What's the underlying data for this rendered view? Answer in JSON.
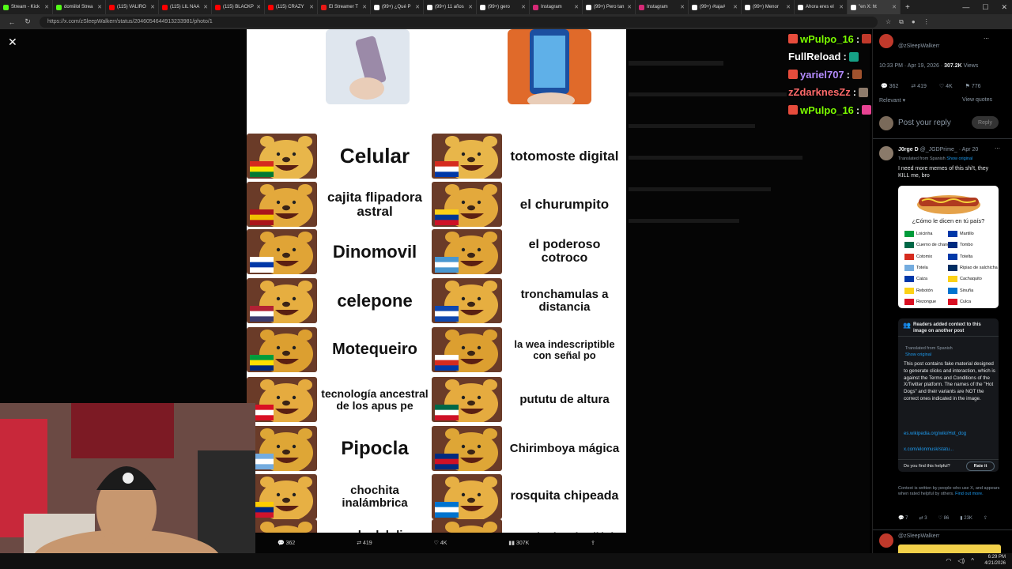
{
  "browser": {
    "tabs": [
      {
        "label": "Stream - Kick",
        "color": "#53fc18"
      },
      {
        "label": "domiilol Strea",
        "color": "#53fc18"
      },
      {
        "label": "(115) VALIRO",
        "color": "#ff0000"
      },
      {
        "label": "(115) LIL NAA",
        "color": "#ff0000"
      },
      {
        "label": "(115) BLACKP",
        "color": "#ff0000"
      },
      {
        "label": "(115) CRAZY",
        "color": "#ff0000"
      },
      {
        "label": "El Streamer T",
        "color": "#e91916"
      },
      {
        "label": "(99+) ¿Qué P",
        "color": "#ffffff"
      },
      {
        "label": "(99+) 11 años",
        "color": "#ffffff"
      },
      {
        "label": "(99+) gero",
        "color": "#ffffff"
      },
      {
        "label": "Instagram",
        "color": "#d62976"
      },
      {
        "label": "(99+) Pero tan",
        "color": "#ffffff"
      },
      {
        "label": "Instagram",
        "color": "#d62976"
      },
      {
        "label": "(99+) #taja#",
        "color": "#ffffff"
      },
      {
        "label": "(99+) Menor",
        "color": "#ffffff"
      },
      {
        "label": "Ahora eres el",
        "color": "#ffffff"
      },
      {
        "label": "\"en X: ht",
        "color": "#ffffff"
      }
    ],
    "url": "https://x.com/zSleepWalkerr/status/2046054644913233981/photo/1"
  },
  "meme": {
    "left": [
      {
        "label": "Celular",
        "pooh": "#e8b64a",
        "flag": [
          "#d52b1e",
          "#f9e300",
          "#007934"
        ]
      },
      {
        "label": "cajita flipadora astral",
        "pooh": "#e3a93c",
        "flag": [
          "#aa151b",
          "#f1bf00",
          "#aa151b"
        ]
      },
      {
        "label": "Dinomovil",
        "pooh": "#e0a436",
        "flag": [
          "#ffffff",
          "#0038a8",
          "#ffffff"
        ]
      },
      {
        "label": "celepone",
        "pooh": "#e6ae40",
        "flag": [
          "#b22234",
          "#ffffff",
          "#3c3b6e"
        ]
      },
      {
        "label": "Motequeiro",
        "pooh": "#dc9f30",
        "flag": [
          "#009c3b",
          "#ffdf00",
          "#002776"
        ]
      },
      {
        "label": "tecnología ancestral de los apus pe",
        "pooh": "#e5ab3f",
        "flag": [
          "#d91023",
          "#ffffff",
          "#d91023"
        ]
      },
      {
        "label": "Pipocla",
        "pooh": "#dea636",
        "flag": [
          "#74acdf",
          "#ffffff",
          "#74acdf"
        ]
      },
      {
        "label": "chochita inalámbrica",
        "pooh": "#e7b044",
        "flag": [
          "#ffcc00",
          "#00247d",
          "#cf142b"
        ]
      },
      {
        "label": "regalo del dios zucaritas",
        "pooh": "#e2a83a",
        "flag": [
          "#002d62",
          "#ffffff",
          "#ce1126"
        ]
      }
    ],
    "right": [
      {
        "label": "totomoste digital",
        "pooh": "#e8b64a",
        "flag": [
          "#d52b1e",
          "#ffffff",
          "#0038a8"
        ]
      },
      {
        "label": "el churumpito",
        "pooh": "#e3a93c",
        "flag": [
          "#fcd116",
          "#003893",
          "#ce1126"
        ]
      },
      {
        "label": "el poderoso cotroco",
        "pooh": "#e0a436",
        "flag": [
          "#4997d0",
          "#ffffff",
          "#4997d0"
        ]
      },
      {
        "label": "tronchamulas a distancia",
        "pooh": "#e6ae40",
        "flag": [
          "#0f47af",
          "#ffffff",
          "#0f47af"
        ]
      },
      {
        "label": "la wea indescriptible con señal po",
        "pooh": "#dc9f30",
        "flag": [
          "#ffffff",
          "#d52b1e",
          "#0039a6"
        ]
      },
      {
        "label": "pututu de altura",
        "pooh": "#e5ab3f",
        "flag": [
          "#006847",
          "#ffffff",
          "#ce1126"
        ]
      },
      {
        "label": "Chirimboya mágica",
        "pooh": "#dea636",
        "flag": [
          "#002b7f",
          "#ce1126",
          "#002b7f"
        ]
      },
      {
        "label": "rosquita chipeada",
        "pooh": "#e7b044",
        "flag": [
          "#0073cf",
          "#ffffff",
          "#0073cf"
        ]
      },
      {
        "label": "tecnología más allá de nuestros conocimientos",
        "pooh": "#e2a83a",
        "flag": [
          "#fcd116",
          "#003893",
          "#ce1126"
        ]
      }
    ]
  },
  "post_actions": {
    "replies": "362",
    "reposts": "419",
    "likes": "4K",
    "views": "307K"
  },
  "chat": [
    {
      "user": "wPulpo_16",
      "color": "#7CFC00"
    },
    {
      "user": "FullReload",
      "color": "#ffffff"
    },
    {
      "user": "yariel707",
      "color": "#b58cff"
    },
    {
      "user": "zZdarknesZz",
      "color": "#ff6a6a"
    },
    {
      "user": "wPulpo_16",
      "color": "#7CFC00"
    }
  ],
  "sidebar": {
    "handle": "@zSleepWalkerr",
    "timestamp": "10:33 PM · Apr 19, 2026",
    "views": "307.2K",
    "views_label": "Views",
    "stats": {
      "replies": "362",
      "reposts": "419",
      "likes": "4K",
      "bookmarks": "776"
    },
    "sort_label": "Relevant",
    "view_quotes": "View quotes",
    "reply_placeholder": "Post your reply",
    "reply_button": "Reply",
    "reply": {
      "name": "J0rge D",
      "handle": "@_JGDPrime_",
      "date": "Apr 20",
      "translated": "Translated from Spanish",
      "show_original": "Show original",
      "text": "I need more memes of this shi't, they KILL me, bro"
    },
    "hotdog": {
      "question": "¿Cómo le dicen en tú país?",
      "left": [
        {
          "name": "Loicinha",
          "flag": "#009c3b"
        },
        {
          "name": "Cuerno de changa",
          "flag": "#006847"
        },
        {
          "name": "Cotomix",
          "flag": "#d52b1e"
        },
        {
          "name": "Totela",
          "flag": "#74acdf"
        },
        {
          "name": "Caiza",
          "flag": "#0038a8"
        },
        {
          "name": "Rebotón",
          "flag": "#fcd116"
        },
        {
          "name": "Rezongue",
          "flag": "#d91023"
        }
      ],
      "right": [
        {
          "name": "Martillo",
          "flag": "#0038a8"
        },
        {
          "name": "Tombo",
          "flag": "#002b7f"
        },
        {
          "name": "Totelta",
          "flag": "#0038a8"
        },
        {
          "name": "Ripiao de salchicha",
          "flag": "#002d62"
        },
        {
          "name": "Cachaquito",
          "flag": "#fcd116"
        },
        {
          "name": "Sinuña",
          "flag": "#0073cf"
        },
        {
          "name": "Culca",
          "flag": "#d91023"
        }
      ]
    },
    "community_note": {
      "title": "Readers added context to this image on another post",
      "translated": "Translated from Spanish",
      "show_original": "Show original",
      "body": "This post contains fake material designed to generate clicks and interaction, which is against the Terms and Conditions of the X/Twitter platform. The names of the \"Hot Dogs\" and their variants are NOT the correct ones indicated in the image.",
      "link1": "es.wikipedia.org/wiki/Hot_dog",
      "link2": "x.com/elonmusk/statu...",
      "helpful": "Do you find this helpful?",
      "rate": "Rate it",
      "footer": "Context is written by people who use X, and appears when rated helpful by others.",
      "find_out": "Find out more."
    },
    "reply_stats": {
      "replies": "7",
      "reposts": "3",
      "likes": "86",
      "views": "23K"
    },
    "next_handle": "@zSleepWalkerr"
  },
  "taskbar": {
    "time": "6:29 PM",
    "date": "4/21/2026"
  }
}
